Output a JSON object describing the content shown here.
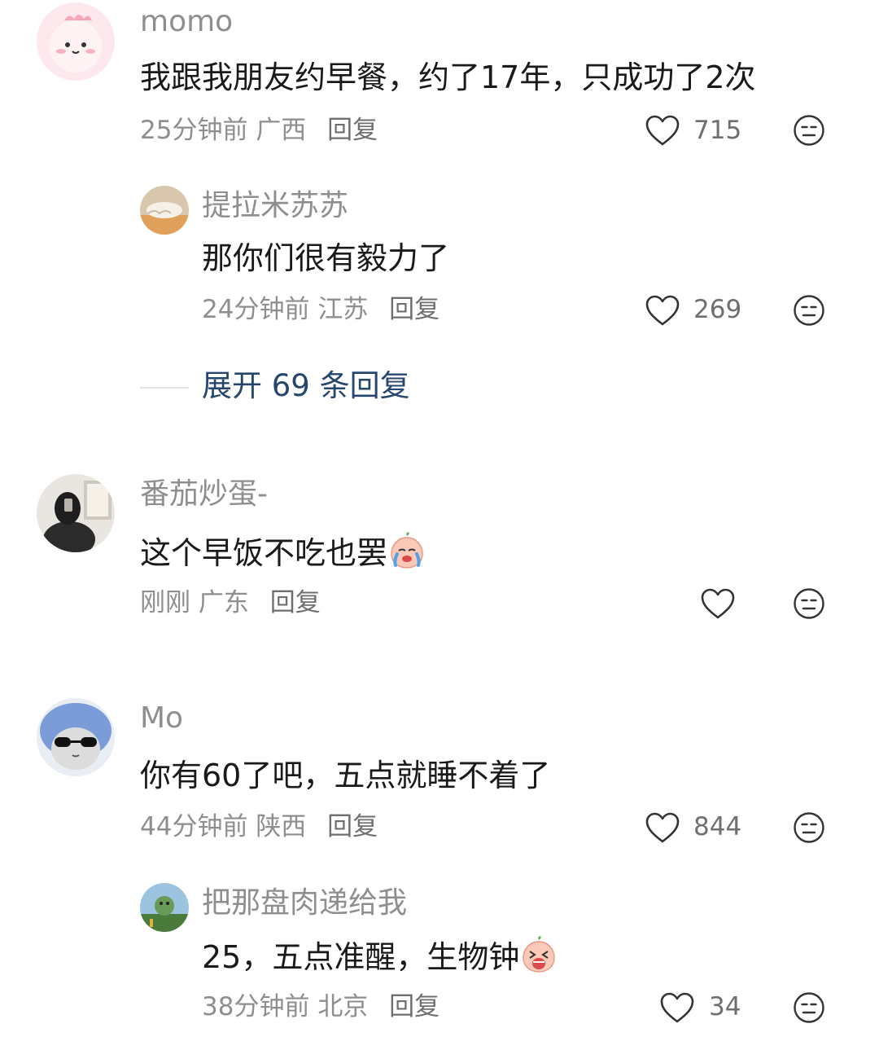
{
  "comments": [
    {
      "username": "momo",
      "content": "我跟我朋友约早餐，约了17年，只成功了2次",
      "time": "25分钟前",
      "location": "广西",
      "reply": "回复",
      "likes": "715",
      "replies": [
        {
          "username": "提拉米苏苏",
          "content": "那你们很有毅力了",
          "time": "24分钟前",
          "location": "江苏",
          "reply": "回复",
          "likes": "269"
        }
      ],
      "expand_label": "展开 69 条回复"
    },
    {
      "username": "番茄炒蛋-",
      "content": "这个早饭不吃也罢",
      "emoji": "crying-peach-emoji",
      "time": "刚刚",
      "location": "广东",
      "reply": "回复",
      "likes": ""
    },
    {
      "username": "Mo",
      "content": "你有60了吧，五点就睡不着了",
      "time": "44分钟前",
      "location": "陕西",
      "reply": "回复",
      "likes": "844",
      "replies": [
        {
          "username": "把那盘肉递给我",
          "content": "25，五点准醒，生物钟",
          "emoji": "screaming-peach-emoji",
          "time": "38分钟前",
          "location": "北京",
          "reply": "回复",
          "likes": "34"
        }
      ]
    }
  ],
  "icons": {
    "like": "heart-outline-icon",
    "dislike": "neutral-face-icon"
  },
  "colors": {
    "username": "#8e8e8e",
    "expand_link": "#27466e"
  }
}
